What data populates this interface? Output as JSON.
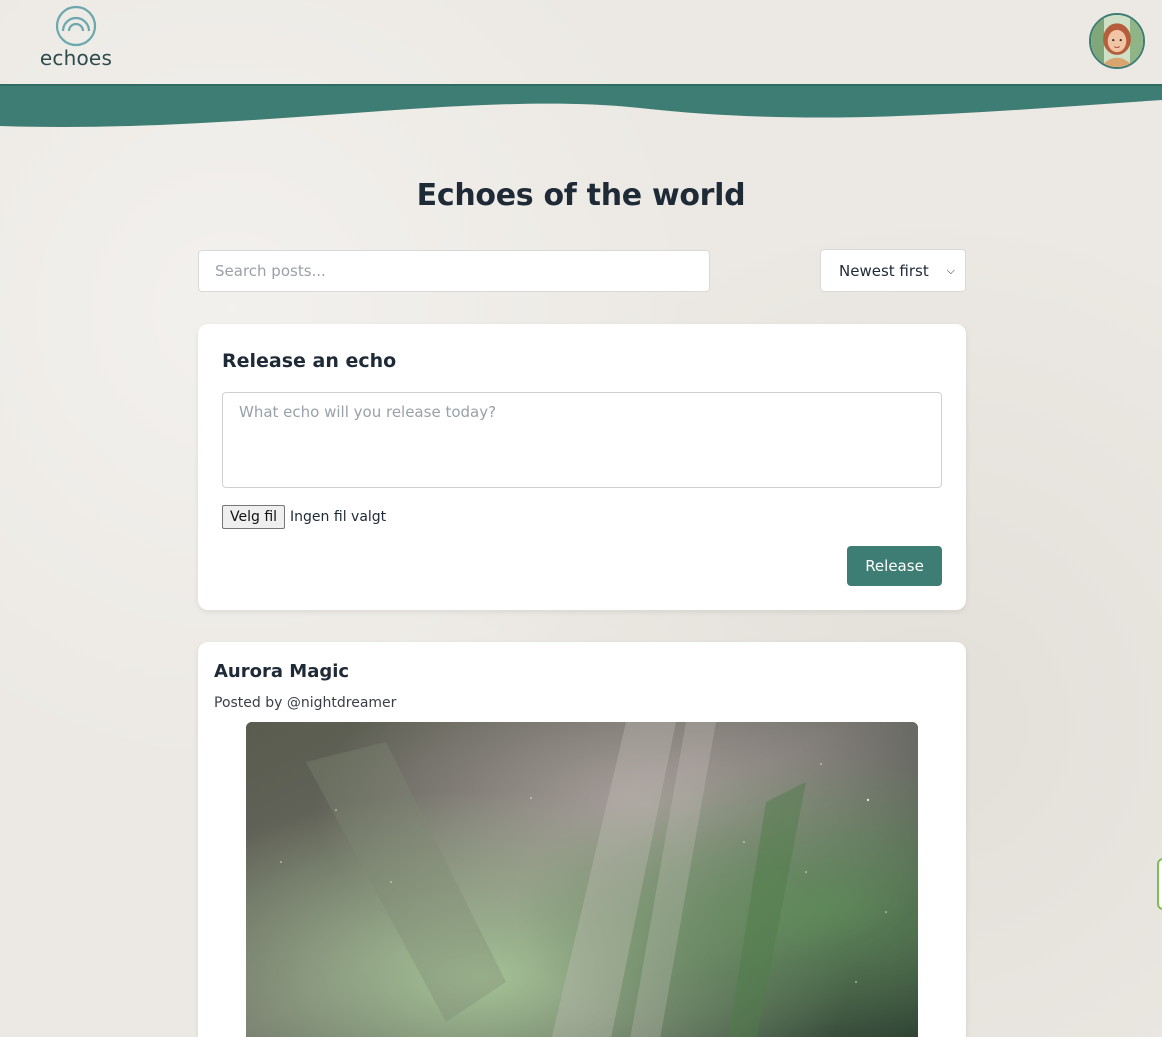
{
  "header": {
    "logo_text": "echoes"
  },
  "main": {
    "title": "Echoes of the world",
    "search": {
      "placeholder": "Search posts..."
    },
    "sort": {
      "selected": "Newest first"
    }
  },
  "composer": {
    "title": "Release an echo",
    "textarea_placeholder": "What echo will you release today?",
    "file_button_label": "Velg fil",
    "file_status": "Ingen fil valgt",
    "submit_label": "Release"
  },
  "posts": [
    {
      "title": "Aurora Magic",
      "meta": "Posted by @nightdreamer"
    }
  ],
  "colors": {
    "accent": "#3e7d74",
    "background": "#ece9e4",
    "card": "#ffffff",
    "text": "#1f2a37"
  },
  "icons": {
    "logo": "echoes-arc-logo-icon",
    "avatar": "user-avatar-icon",
    "sort_chevron": "chevron-down-icon"
  }
}
